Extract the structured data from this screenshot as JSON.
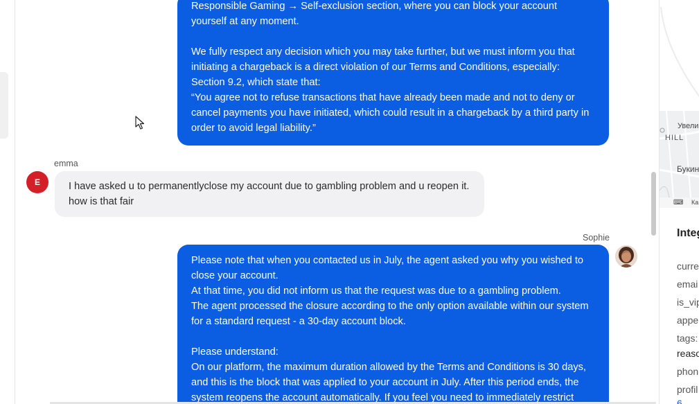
{
  "chat": {
    "messages": [
      {
        "sender": "",
        "role": "agent",
        "paragraphs": [
          "Responsible Gaming → Self-exclusion section, where you can block your account yourself at any moment.",
          "We fully respect any decision which you may take further, but we must inform you that initiating a chargeback is a direct violation of our Terms and Conditions, especially: Section 9.2, which state that:\n“You agree not to refuse transactions that have already been made and not to deny or cancel payments you have initiated, which could result in a chargeback by a third party in order to avoid legal liability.”"
        ]
      },
      {
        "sender": "emma",
        "avatar_initial": "E",
        "role": "user",
        "text": "I have asked u to permanentlyclose my account due to gambling problem and u reopen it. how is that fair"
      },
      {
        "sender": "Sophie",
        "role": "agent",
        "paragraphs": [
          "Please note that when you contacted us in July, the agent asked you why you wished to close your account.\nAt that time, you did not inform us that the request was due to a gambling problem.\nThe agent processed the closure according to the only option available within our system for a standard request - a 30-day account block.",
          "Please understand:\nOn our platform, the maximum duration allowed by the Terms and Conditions is 30 days, and this is the block that was applied to your account in July. After this period ends, the system reopens the account automatically. If you feel you need to immediately restrict"
        ]
      }
    ]
  },
  "right_panel": {
    "map_labels": {
      "zoom": "Увели",
      "hill": "HILL",
      "place": "Букин",
      "footer": "Ка"
    },
    "title": "Integ",
    "fields": [
      "curre",
      "emai",
      "is_vip",
      "appe",
      "tags:"
    ],
    "tag_value": "reaso",
    "fields_after": [
      "phon",
      "profil"
    ],
    "profile_link": "6"
  },
  "colors": {
    "agent_bubble": "#0b5de1",
    "user_bubble": "#f1f1f3",
    "user_avatar": "#d32028"
  }
}
